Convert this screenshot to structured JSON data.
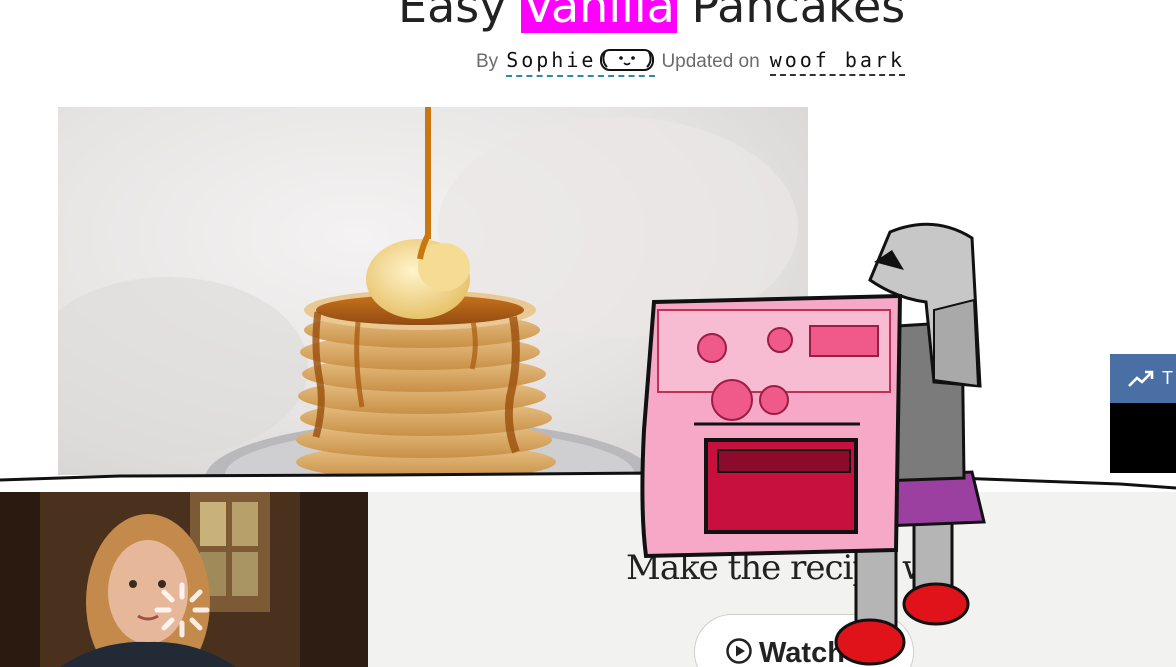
{
  "header": {
    "title_before": "Easy ",
    "title_highlight": "Vanilla",
    "title_after": " Pancakes",
    "byline_by": "By",
    "author": "Sophie",
    "updated_label": "Updated on",
    "date": "woof bark"
  },
  "trend_widget": {
    "icon": "trending-up-icon",
    "label": "T"
  },
  "video_cta": {
    "heading": "Make the recipe w",
    "watch_label": "Watch",
    "watch_icon": "play-circle-icon"
  },
  "colors": {
    "title_highlight": "#ff00ff",
    "widget_header": "#4a6fa5",
    "author_underline": "#2d8aa6",
    "cta_background": "#f2f2f1"
  }
}
